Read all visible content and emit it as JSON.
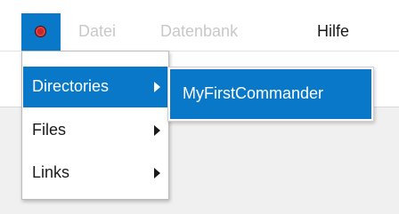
{
  "menubar": {
    "app_icon": "app-circle-icon",
    "items": [
      {
        "label": "Datei",
        "enabled": false
      },
      {
        "label": "Datenbank",
        "enabled": false
      },
      {
        "label": "Hilfe",
        "enabled": true
      }
    ]
  },
  "dropdown": {
    "items": [
      {
        "label": "Directories",
        "has_submenu": true,
        "selected": true
      },
      {
        "label": "Files",
        "has_submenu": true,
        "selected": false
      },
      {
        "label": "Links",
        "has_submenu": true,
        "selected": false
      }
    ]
  },
  "submenu": {
    "items": [
      {
        "label": "MyFirstCommander",
        "selected": true
      }
    ]
  },
  "colors": {
    "accent": "#0a78c8",
    "menubar_bg": "#ffffff",
    "disabled_text": "#c8c8c8"
  }
}
